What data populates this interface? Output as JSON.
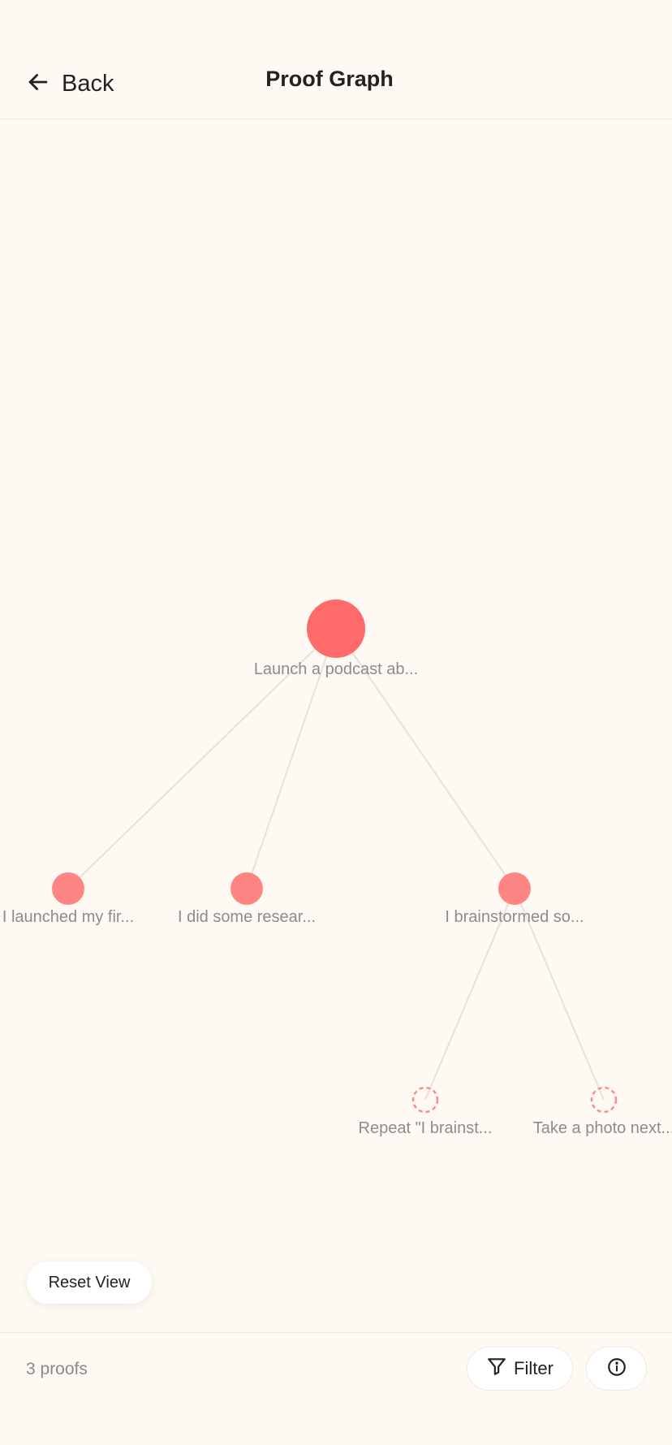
{
  "header": {
    "back_label": "Back",
    "back_icon": "arrow-left-icon",
    "title": "Proof Graph"
  },
  "graph": {
    "colors": {
      "root": "#FF6B6B",
      "proof": "#FF8585",
      "suggestion_stroke": "#FF8A8A",
      "edge": "#E6E2DA"
    },
    "nodes": [
      {
        "id": "root",
        "label": "Launch a podcast ab...",
        "kind": "goal"
      },
      {
        "id": "p1",
        "label": "I launched my fir...",
        "kind": "proof"
      },
      {
        "id": "p2",
        "label": "I did some resear...",
        "kind": "proof"
      },
      {
        "id": "p3",
        "label": "I brainstormed so...",
        "kind": "proof"
      },
      {
        "id": "s1",
        "label": "Repeat \"I brainst...",
        "kind": "suggestion"
      },
      {
        "id": "s2",
        "label": "Take a photo next...",
        "kind": "suggestion"
      }
    ],
    "edges": [
      [
        "root",
        "p1"
      ],
      [
        "root",
        "p2"
      ],
      [
        "root",
        "p3"
      ],
      [
        "p3",
        "s1"
      ],
      [
        "p3",
        "s2"
      ]
    ]
  },
  "controls": {
    "reset_label": "Reset View"
  },
  "footer": {
    "count_text": "3 proofs",
    "filter_label": "Filter",
    "filter_icon": "filter-icon",
    "info_icon": "info-icon"
  }
}
